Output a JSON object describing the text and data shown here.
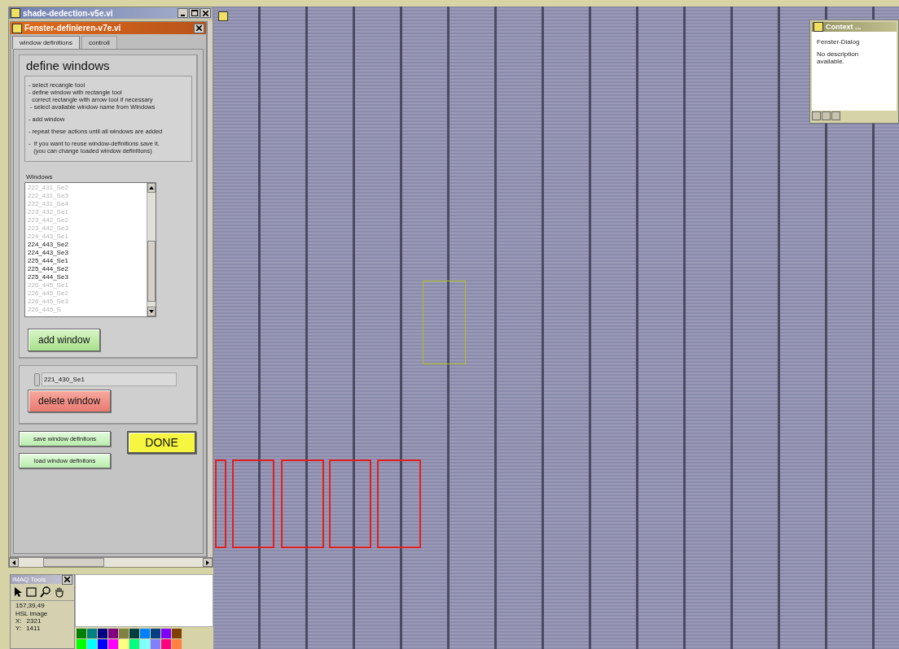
{
  "main_window": {
    "title": "shade-dedection-v5e.vi"
  },
  "dialog": {
    "title": "Fenster-definieren-v7e.vi"
  },
  "tabs": [
    {
      "label": "window definitions",
      "selected": true
    },
    {
      "label": "controll",
      "selected": false
    }
  ],
  "instructions": {
    "heading": "define windows",
    "groups": [
      [
        "- select recangle tool",
        "- define window with rectangle tool",
        "  correct rectangle with arrow tool if necessary",
        " - select available window name from Windows"
      ],
      [
        "- add window"
      ],
      [
        "- repeat these actions until all windows are added"
      ],
      [
        "-  if you want to reuse window-definitions save it.",
        "   (you can change loaded window definitions)"
      ]
    ]
  },
  "windows_list": {
    "label": "Windows",
    "items": [
      {
        "name": "222_431_Se2",
        "disabled": true
      },
      {
        "name": "222_431_Se3",
        "disabled": true
      },
      {
        "name": "222_431_Se4",
        "disabled": true
      },
      {
        "name": "223_432_Se1",
        "disabled": true
      },
      {
        "name": "223_442_Se2",
        "disabled": true
      },
      {
        "name": "223_442_Se3",
        "disabled": true
      },
      {
        "name": "224_443_Se1",
        "disabled": true
      },
      {
        "name": "224_443_Se2",
        "disabled": false
      },
      {
        "name": "224_443_Se3",
        "disabled": false
      },
      {
        "name": "225_444_Se1",
        "disabled": false
      },
      {
        "name": "225_444_Se2",
        "disabled": false
      },
      {
        "name": "225_444_Se3",
        "disabled": false
      },
      {
        "name": "226_445_Se1",
        "disabled": true
      },
      {
        "name": "226_445_Se2",
        "disabled": true
      },
      {
        "name": "226_445_Se3",
        "disabled": true
      },
      {
        "name": "226_445_S",
        "disabled": true
      }
    ]
  },
  "add_button": "add window",
  "selector": {
    "value": "221_430_Se1"
  },
  "delete_button": "delete window",
  "save_button": "save window definitons",
  "load_button": "load window definitons",
  "done_button": "DONE",
  "imaq_tools": {
    "title": "IMAQ Tools",
    "pixel_value": "157,39,49",
    "image_type": "HSL image",
    "x_label": "X:",
    "x_value": "2321",
    "y_label": "Y:",
    "y_value": "1411"
  },
  "palette": [
    {
      "color": "#008000"
    },
    {
      "color": "#008080"
    },
    {
      "color": "#000080"
    },
    {
      "color": "#800080"
    },
    {
      "color": "#808040"
    },
    {
      "color": "#004040"
    },
    {
      "color": "#0080ff"
    },
    {
      "color": "#004080"
    },
    {
      "color": "#8000ff"
    },
    {
      "color": "#804000"
    },
    {
      "color": "#00ff00"
    },
    {
      "color": "#00ffff"
    },
    {
      "color": "#0000ff"
    },
    {
      "color": "#ff00ff"
    },
    {
      "color": "#ffff80"
    },
    {
      "color": "#00ff80"
    },
    {
      "color": "#80ffff"
    },
    {
      "color": "#8080ff"
    },
    {
      "color": "#ff0080"
    },
    {
      "color": "#ff8040"
    }
  ],
  "rois": [
    {
      "selected": true
    },
    {
      "selected": false
    },
    {
      "selected": false
    },
    {
      "selected": false
    },
    {
      "selected": false
    },
    {
      "selected": false
    }
  ],
  "context_help": {
    "title": "Context ...",
    "vi_name": "Fenster-Dialog",
    "description": "No description available."
  }
}
